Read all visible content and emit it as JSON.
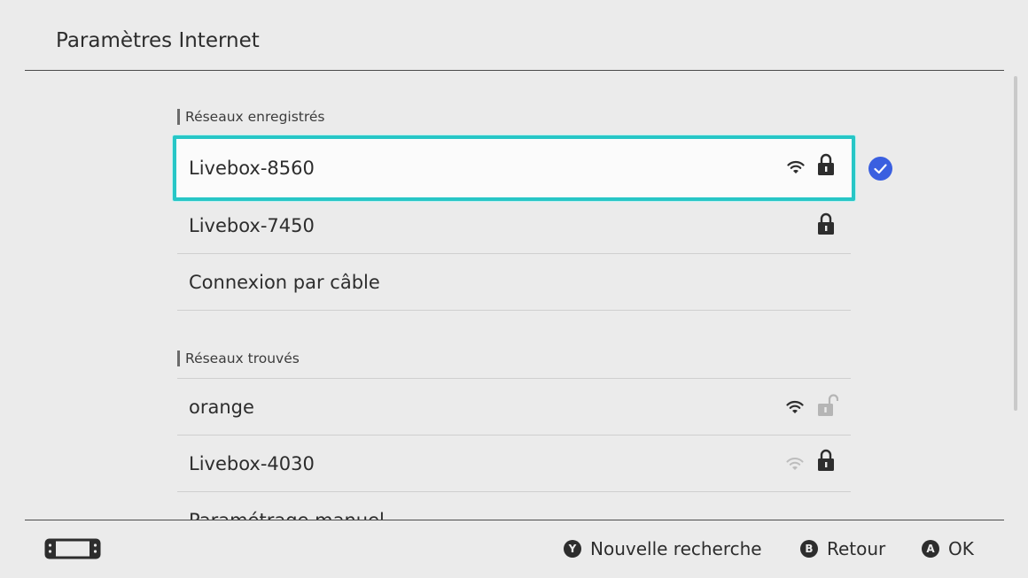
{
  "header": {
    "title": "Paramètres Internet"
  },
  "sections": {
    "registered": {
      "label": "Réseaux enregistrés",
      "items": [
        {
          "name": "Livebox-8560",
          "wifi": "strong",
          "lock": "locked",
          "selected": true,
          "connected": true
        },
        {
          "name": "Livebox-7450",
          "wifi": "none",
          "lock": "locked"
        },
        {
          "name": "Connexion par câble",
          "wifi": "none",
          "lock": "none"
        }
      ]
    },
    "found": {
      "label": "Réseaux trouvés",
      "items": [
        {
          "name": "orange",
          "wifi": "strong",
          "lock": "open-dimmed"
        },
        {
          "name": "Livebox-4030",
          "wifi": "weak",
          "lock": "locked"
        },
        {
          "name": "Paramétrage manuel",
          "wifi": "none",
          "lock": "none"
        }
      ]
    }
  },
  "footer": {
    "buttons": [
      {
        "glyph": "Y",
        "label": "Nouvelle recherche"
      },
      {
        "glyph": "B",
        "label": "Retour"
      },
      {
        "glyph": "A",
        "label": "OK"
      }
    ]
  },
  "colors": {
    "accent": "#27c6c6",
    "check": "#3a5fe0",
    "background": "#ebebeb",
    "text": "#2d2d2d"
  },
  "icons": {
    "wifi": "wifi-icon",
    "lock": "lock-icon",
    "check": "check-icon",
    "console": "handheld-console-icon"
  }
}
